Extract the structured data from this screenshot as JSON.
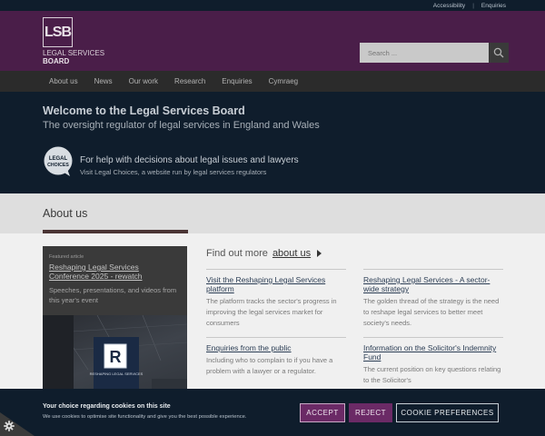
{
  "topbar": {
    "accessibility": "Accessibility",
    "separator": "|",
    "enquiries": "Enquiries"
  },
  "logo": {
    "mark": "LSB",
    "line1": "LEGAL SERVICES",
    "line2": "BOARD"
  },
  "search": {
    "placeholder": "Search ..."
  },
  "nav": {
    "items": [
      "About us",
      "News",
      "Our work",
      "Research",
      "Enquiries",
      "Cymraeg"
    ]
  },
  "hero": {
    "title": "Welcome to the Legal Services Board",
    "subtitle": "The oversight regulator of legal services in England and Wales",
    "badge_line1": "LEGAL",
    "badge_line2": "CHOICES",
    "lc_title": "For help with decisions about legal issues and lawyers",
    "lc_sub": "Visit Legal Choices, a website run by legal services regulators"
  },
  "section": {
    "title": "About us"
  },
  "featured": {
    "label": "Featured article",
    "link": "Reshaping Legal Services Conference 2025 - rewatch",
    "desc": "Speeches, presentations, and videos from this year's event",
    "banner_brand": "RESHAPING LEGAL SERVICES"
  },
  "findout": {
    "prefix": "Find out more",
    "link": "about us"
  },
  "cards": [
    {
      "title": "Visit the Reshaping Legal Services platform",
      "desc": "The platform tracks the sector's progress in improving the legal services market for consumers"
    },
    {
      "title": "Reshaping Legal Services - A sector-wide strategy",
      "desc": "The golden thread of the strategy is the need to reshape legal services to better meet society's needs."
    },
    {
      "title": "Enquiries from the public",
      "desc": "Including who to complain to if you have a problem with a lawyer or a regulator."
    },
    {
      "title": "Information on the Solicitor's Indemnity Fund",
      "desc": "The current position on key questions relating to the Solicitor's"
    }
  ],
  "cookie": {
    "title": "Your choice regarding cookies on this site",
    "text": "We use cookies to optimise site functionality and give you the best possible experience.",
    "accept": "ACCEPT",
    "reject": "REJECT",
    "prefs": "COOKIE PREFERENCES"
  },
  "colors": {
    "purple": "#4a1e49",
    "navy": "#0f1d2c",
    "nav": "#2b2b2b",
    "accent": "#6b2a66"
  }
}
